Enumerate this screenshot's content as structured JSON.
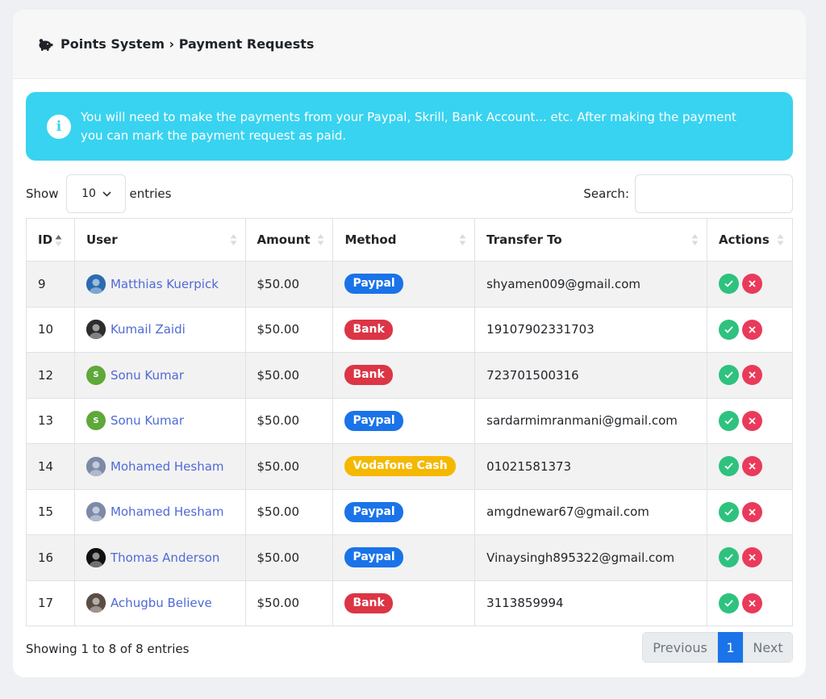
{
  "header": {
    "title": "Points System › Payment Requests"
  },
  "alert": {
    "text": "You will need to make the payments from your Paypal, Skrill, Bank Account... etc. After making the payment you can mark the payment request as paid."
  },
  "length": {
    "prefix": "Show",
    "value": "10",
    "suffix": "entries"
  },
  "search": {
    "label": "Search:",
    "value": ""
  },
  "columns": [
    "ID",
    "User",
    "Amount",
    "Method",
    "Transfer To",
    "Actions"
  ],
  "rows": [
    {
      "id": "9",
      "user": "Matthias Kuerpick",
      "amount": "$50.00",
      "method": "Paypal",
      "method_color": "#1a73e8",
      "transfer": "shyamen009@gmail.com",
      "avatar": "photo",
      "avatar_color": "#2b6cb0"
    },
    {
      "id": "10",
      "user": "Kumail Zaidi",
      "amount": "$50.00",
      "method": "Bank",
      "method_color": "#dc3545",
      "transfer": "19107902331703",
      "avatar": "photo",
      "avatar_color": "#2d2d2d"
    },
    {
      "id": "12",
      "user": "Sonu Kumar",
      "amount": "$50.00",
      "method": "Bank",
      "method_color": "#dc3545",
      "transfer": "723701500316",
      "avatar": "S",
      "avatar_color": "#5fa83a"
    },
    {
      "id": "13",
      "user": "Sonu Kumar",
      "amount": "$50.00",
      "method": "Paypal",
      "method_color": "#1a73e8",
      "transfer": "sardarmimranmani@gmail.com",
      "avatar": "S",
      "avatar_color": "#5fa83a"
    },
    {
      "id": "14",
      "user": "Mohamed Hesham",
      "amount": "$50.00",
      "method": "Vodafone Cash",
      "method_color": "#f5b800",
      "transfer": "01021581373",
      "avatar": "photo",
      "avatar_color": "#7c8aa8"
    },
    {
      "id": "15",
      "user": "Mohamed Hesham",
      "amount": "$50.00",
      "method": "Paypal",
      "method_color": "#1a73e8",
      "transfer": "amgdnewar67@gmail.com",
      "avatar": "photo",
      "avatar_color": "#7c8aa8"
    },
    {
      "id": "16",
      "user": "Thomas Anderson",
      "amount": "$50.00",
      "method": "Paypal",
      "method_color": "#1a73e8",
      "transfer": "Vinaysingh895322@gmail.com",
      "avatar": "photo",
      "avatar_color": "#111111"
    },
    {
      "id": "17",
      "user": "Achugbu Believe",
      "amount": "$50.00",
      "method": "Bank",
      "method_color": "#dc3545",
      "transfer": "3113859994",
      "avatar": "photo",
      "avatar_color": "#5a4e44"
    }
  ],
  "footer": {
    "info": "Showing 1 to 8 of 8 entries"
  },
  "pagination": {
    "previous": "Previous",
    "current": "1",
    "next": "Next"
  }
}
